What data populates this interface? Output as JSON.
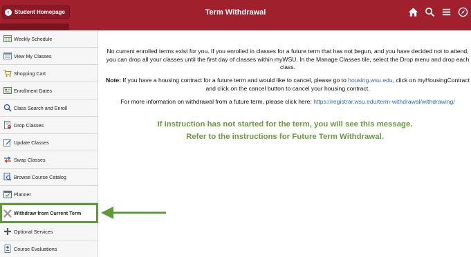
{
  "header": {
    "home_label": "Student Homepage",
    "title": "Term Withdrawal",
    "icons": [
      "home-icon",
      "search-icon",
      "menu-icon",
      "navigation-compass-icon"
    ]
  },
  "sidebar": {
    "items": [
      {
        "label": "Weekly Schedule",
        "icon": "calendar-grid-icon"
      },
      {
        "label": "View My Classes",
        "icon": "classes-list-icon"
      },
      {
        "label": "Shopping Cart",
        "icon": "shopping-cart-icon"
      },
      {
        "label": "Enrollment Dates",
        "icon": "enrollment-dates-icon"
      },
      {
        "label": "Class Search and Enroll",
        "icon": "search-icon"
      },
      {
        "label": "Drop Classes",
        "icon": "drop-classes-icon"
      },
      {
        "label": "Update Classes",
        "icon": "edit-icon"
      },
      {
        "label": "Swap Classes",
        "icon": "swap-arrows-icon"
      },
      {
        "label": "Browse Course Catalog",
        "icon": "catalog-icon"
      },
      {
        "label": "Planner",
        "icon": "planner-icon"
      },
      {
        "label": "Withdraw from Current Term",
        "icon": "withdraw-x-icon",
        "active": true
      },
      {
        "label": "Optional Services",
        "icon": "plus-icon"
      },
      {
        "label": "Course Evaluations",
        "icon": "evaluation-icon"
      }
    ]
  },
  "main": {
    "message": "No current enrolled terms exist for you. If you enrolled in classes for a future term that has not begun, and you have decided not to attend, you can drop all your classes until the first day of classes within myWSU. In the Manage Classes tile, select the Drop menu and drop each class.",
    "note_label": "Note:",
    "note_pre": " If you have a housing contract for a future term and would like to cancel, please go to ",
    "note_link": "housing.wsu.edu",
    "note_post": ", click on myHousingContract and click on the cancel button to cancel your housing contract.",
    "info_pre": "For more information on withdrawal from a future term, please click here: ",
    "info_link": "https://registrar.wsu.edu/term-withdrawal/withdrawing/",
    "annotation_line1": "If instruction has not started for the term, you will see this message.",
    "annotation_line2": "Refer to the instructions for Future Term Withdrawal."
  },
  "colors": {
    "header_bg": "#a0202e",
    "annotation_green": "#6a9a3c",
    "link_blue": "#2f6ab0"
  }
}
